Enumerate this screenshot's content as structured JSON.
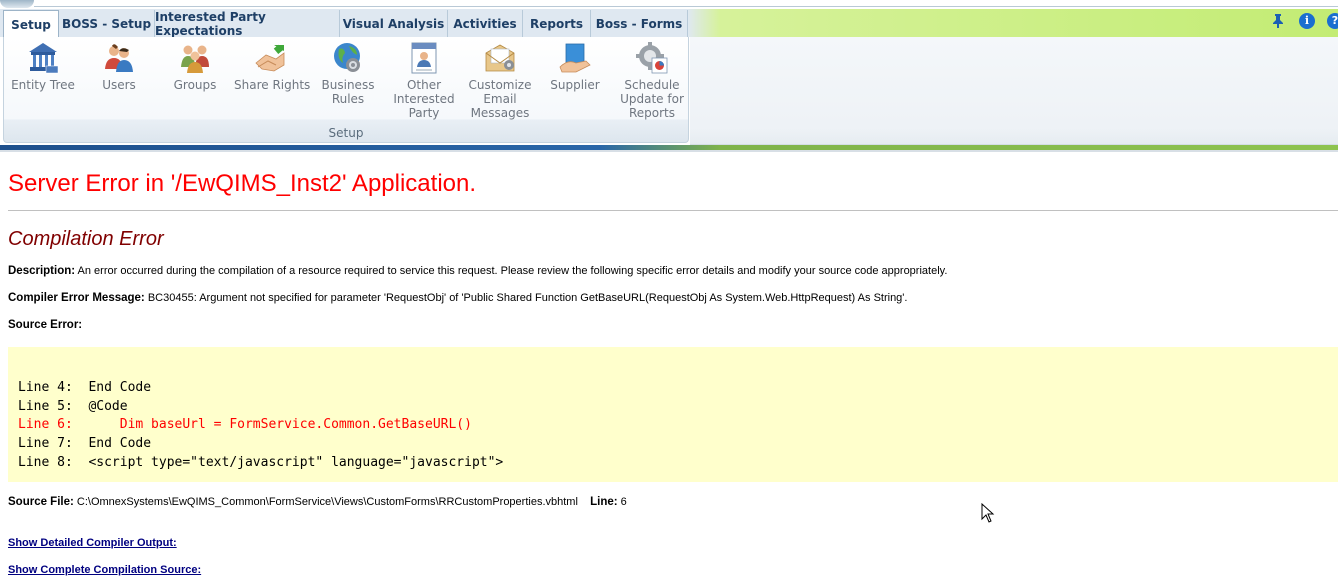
{
  "ribbon": {
    "tabs": [
      {
        "label": "Setup",
        "active": true
      },
      {
        "label": "BOSS - Setup"
      },
      {
        "label": "Interested Party Expectations"
      },
      {
        "label": "Visual Analysis"
      },
      {
        "label": "Activities"
      },
      {
        "label": "Reports"
      },
      {
        "label": "Boss - Forms"
      }
    ],
    "buttons": [
      {
        "label": "Entity Tree",
        "icon": "entity-tree-icon"
      },
      {
        "label": "Users",
        "icon": "users-icon"
      },
      {
        "label": "Groups",
        "icon": "groups-icon"
      },
      {
        "label": "Share Rights",
        "icon": "share-rights-icon"
      },
      {
        "label": "Business\nRules",
        "icon": "business-rules-icon"
      },
      {
        "label": "Other\nInterested\nParty",
        "icon": "other-party-icon"
      },
      {
        "label": "Customize\nEmail\nMessages",
        "icon": "email-icon"
      },
      {
        "label": "Supplier",
        "icon": "supplier-icon"
      },
      {
        "label": "Schedule\nUpdate for\nReports",
        "icon": "schedule-icon"
      }
    ],
    "group_label": "Setup",
    "right_icons": [
      "pin-icon",
      "info-icon",
      "help-icon"
    ]
  },
  "error": {
    "title": "Server Error in '/EwQIMS_Inst2' Application.",
    "subtitle": "Compilation Error",
    "description_label": "Description:",
    "description_text": " An error occurred during the compilation of a resource required to service this request. Please review the following specific error details and modify your source code appropriately.",
    "compiler_label": "Compiler Error Message:",
    "compiler_text": " BC30455: Argument not specified for parameter 'RequestObj' of 'Public Shared Function GetBaseURL(RequestObj As System.Web.HttpRequest) As String'.",
    "source_error_label": "Source Error:",
    "code_lines": [
      {
        "text": "Line 4:  End Code",
        "error": false
      },
      {
        "text": "Line 5:  @Code",
        "error": false
      },
      {
        "text": "Line 6:      Dim baseUrl = FormService.Common.GetBaseURL()",
        "error": true
      },
      {
        "text": "Line 7:  End Code",
        "error": false
      },
      {
        "text": "Line 8:  <script type=\"text/javascript\" language=\"javascript\">",
        "error": false
      }
    ],
    "source_file_label": "Source File:",
    "source_file_path": " C:\\OmnexSystems\\EwQIMS_Common\\FormService\\Views\\CustomForms\\RRCustomProperties.vbhtml",
    "line_label": "Line:",
    "line_value": " 6",
    "link_compiler_output": "Show Detailed Compiler Output:",
    "link_compilation_source": "Show Complete Compilation Source:"
  },
  "colors": {
    "error_title": "#ff0000",
    "error_subtitle": "#800000",
    "code_background": "#ffffcc",
    "link": "#000080"
  }
}
